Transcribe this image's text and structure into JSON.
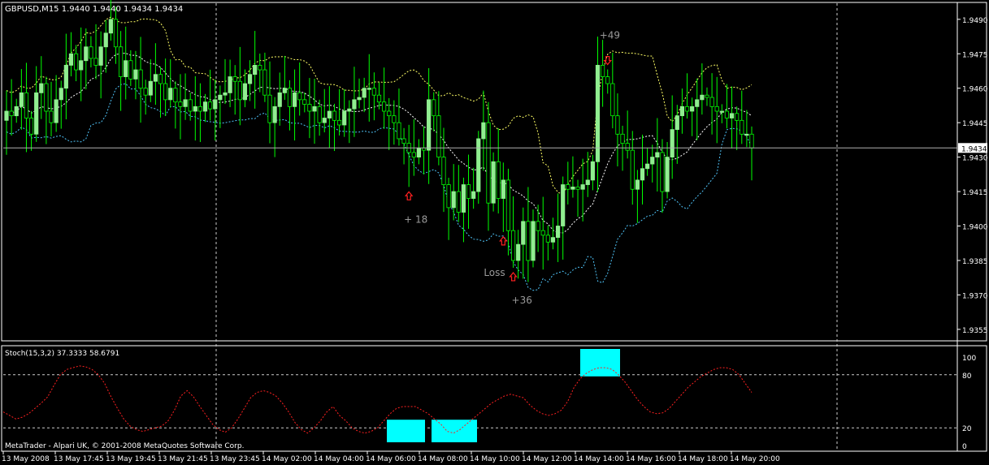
{
  "window": {
    "header": "GBPUSD,M15  1.9440 1.9440 1.9434 1.9434",
    "indicator_header": "Stoch(15,3,2) 37.3333 58.6791",
    "copyright": "MetaTrader - Alpari UK, © 2001-2008 MetaQuotes Software Corp.",
    "current_price_label": "1.9434"
  },
  "colors": {
    "background": "#000000",
    "frame": "#ffffff",
    "bull_candle": "#90ee90",
    "wick": "#00ff00",
    "band_upper": "#ffff66",
    "band_middle": "#ffffff",
    "band_lower": "#4fc3f7",
    "stochastic": "#ff2020",
    "highlight": "#00ffff",
    "arrow": "#ff2020",
    "annotation": "#9a9a9a"
  },
  "chart_data": [
    {
      "type": "candlestick",
      "symbol": "GBPUSD",
      "timeframe": "M15",
      "ylim": [
        1.935,
        1.9497
      ],
      "yticks": [
        "1.9490",
        "1.9475",
        "1.9460",
        "1.9445",
        "1.9430",
        "1.9415",
        "1.9400",
        "1.9385",
        "1.9370",
        "1.9355"
      ],
      "xticks": [
        "13 May 2008",
        "13 May 17:45",
        "13 May 19:45",
        "13 May 21:45",
        "13 May 23:45",
        "14 May 02:00",
        "14 May 04:00",
        "14 May 06:00",
        "14 May 08:00",
        "14 May 10:00",
        "14 May 12:00",
        "14 May 14:00",
        "14 May 16:00",
        "14 May 18:00",
        "14 May 20:00"
      ],
      "current_price": 1.9434,
      "closes": [
        1.945,
        1.9448,
        1.9452,
        1.9458,
        1.9447,
        1.944,
        1.9458,
        1.9462,
        1.945,
        1.9445,
        1.9455,
        1.946,
        1.947,
        1.9475,
        1.9468,
        1.9472,
        1.9478,
        1.9473,
        1.947,
        1.9478,
        1.9484,
        1.949,
        1.9478,
        1.9465,
        1.9472,
        1.9464,
        1.9468,
        1.946,
        1.9457,
        1.9463,
        1.9466,
        1.9462,
        1.9455,
        1.946,
        1.9454,
        1.9452,
        1.9455,
        1.945,
        1.9452,
        1.945,
        1.9454,
        1.9451,
        1.9455,
        1.9457,
        1.9458,
        1.9465,
        1.9463,
        1.9455,
        1.9462,
        1.9466,
        1.947,
        1.9468,
        1.9457,
        1.9445,
        1.9452,
        1.9458,
        1.946,
        1.9452,
        1.9458,
        1.9455,
        1.9453,
        1.945,
        1.9452,
        1.9445,
        1.9447,
        1.945,
        1.9446,
        1.9444,
        1.945,
        1.9451,
        1.9455,
        1.9456,
        1.946,
        1.946,
        1.9457,
        1.9454,
        1.945,
        1.9448,
        1.9445,
        1.9438,
        1.9436,
        1.9432,
        1.943,
        1.9434,
        1.9433,
        1.9455,
        1.9448,
        1.943,
        1.9418,
        1.9408,
        1.9415,
        1.9406,
        1.9418,
        1.9412,
        1.9415,
        1.9438,
        1.9445,
        1.941,
        1.9428,
        1.9412,
        1.942,
        1.9398,
        1.9385,
        1.9392,
        1.9402,
        1.9385,
        1.9402,
        1.9398,
        1.9396,
        1.9393,
        1.9395,
        1.94,
        1.9418,
        1.9416,
        1.9417,
        1.9416,
        1.9418,
        1.942,
        1.9428,
        1.947,
        1.9465,
        1.9462,
        1.9448,
        1.944,
        1.9436,
        1.9433,
        1.9416,
        1.942,
        1.9425,
        1.9427,
        1.943,
        1.9432,
        1.9415,
        1.943,
        1.9442,
        1.9448,
        1.9452,
        1.945,
        1.9452,
        1.9455,
        1.9457,
        1.9456,
        1.9452,
        1.945,
        1.945,
        1.9447,
        1.9449,
        1.9446,
        1.944,
        1.944,
        1.9434
      ],
      "annotations": [
        {
          "text": "+ 18",
          "arrow": "up"
        },
        {
          "text": "+36",
          "arrow": "up"
        },
        {
          "text": "Loss",
          "arrow": "up"
        },
        {
          "text": "+49",
          "arrow": "down"
        }
      ]
    },
    {
      "type": "line",
      "name": "Stoch(15,3,2)",
      "ylim": [
        0,
        100
      ],
      "yticks": [
        "100",
        "80",
        "20",
        "0"
      ],
      "levels": [
        20,
        80
      ],
      "values": [
        38,
        34,
        30,
        32,
        36,
        42,
        48,
        55,
        68,
        80,
        86,
        88,
        90,
        89,
        86,
        80,
        70,
        55,
        42,
        30,
        22,
        18,
        16,
        18,
        20,
        22,
        28,
        40,
        56,
        62,
        55,
        44,
        34,
        24,
        18,
        15,
        20,
        30,
        42,
        54,
        60,
        62,
        60,
        56,
        48,
        38,
        26,
        18,
        14,
        20,
        28,
        38,
        44,
        34,
        28,
        20,
        16,
        14,
        16,
        20,
        28,
        36,
        42,
        44,
        44,
        44,
        40,
        36,
        30,
        24,
        16,
        14,
        18,
        24,
        30,
        36,
        42,
        48,
        52,
        56,
        58,
        56,
        54,
        46,
        40,
        36,
        34,
        36,
        40,
        50,
        66,
        76,
        82,
        86,
        88,
        88,
        86,
        80,
        72,
        62,
        52,
        44,
        38,
        36,
        37,
        42,
        50,
        58,
        66,
        72,
        78,
        82,
        86,
        88,
        88,
        86,
        80,
        70,
        60
      ],
      "highlights": [
        {
          "band": "low",
          "range": [
            0,
            20
          ]
        },
        {
          "band": "low",
          "range": [
            0,
            20
          ]
        },
        {
          "band": "high",
          "range": [
            80,
            100
          ]
        }
      ]
    }
  ]
}
